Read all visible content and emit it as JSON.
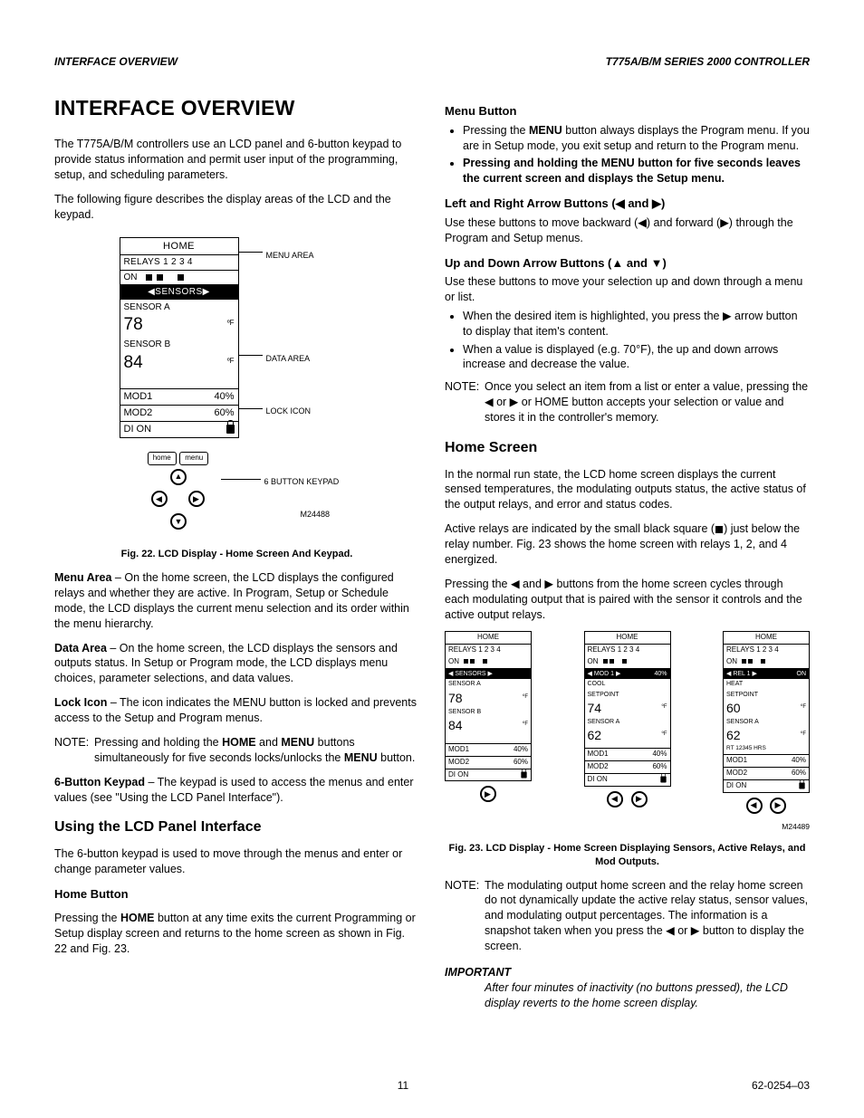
{
  "header": {
    "left": "INTERFACE OVERVIEW",
    "right": "T775A/B/M SERIES 2000 CONTROLLER"
  },
  "left": {
    "h1": "INTERFACE OVERVIEW",
    "p1": "The T775A/B/M controllers use an LCD panel and 6-button keypad to provide status information and permit user input of the programming, setup, and scheduling parameters.",
    "p2": "The following figure describes the display areas of the LCD and the keypad.",
    "fig1": {
      "home": "HOME",
      "relays": "RELAYS  1  2  3  4",
      "on": "ON",
      "sensors_hdr": "◀SENSORS▶",
      "sensor_a": "SENSOR A",
      "val_a": "78",
      "sensor_b": "SENSOR B",
      "val_b": "84",
      "deg": "ºF",
      "mod1": "MOD1",
      "mod1v": "40%",
      "mod2": "MOD2",
      "mod2v": "60%",
      "di": "DI ON",
      "btn_home": "home",
      "btn_menu": "menu",
      "callouts": {
        "menu": "MENU AREA",
        "data": "DATA AREA",
        "lock": "LOCK ICON",
        "keypad": "6 BUTTON KEYPAD",
        "code": "M24488"
      },
      "caption": "Fig. 22. LCD Display - Home Screen And Keypad."
    },
    "menu_area_label": "Menu Area",
    "menu_area": " – On the home screen, the LCD displays the configured relays and whether they are active. In Program, Setup or Schedule mode, the LCD displays the current menu selection and its order within the menu hierarchy.",
    "data_area_label": "Data Area",
    "data_area": " – On the home screen, the LCD displays the sensors and outputs status. In Setup or Program mode, the LCD displays menu choices, parameter selections, and data values.",
    "lock_icon_label": "Lock Icon",
    "lock_icon": " – The icon indicates the MENU button is locked and prevents access to the Setup and Program menus.",
    "note1_label": "NOTE:",
    "note1": "Pressing and holding the HOME and MENU buttons simultaneously for five seconds locks/unlocks the MENU button.",
    "keypad_label": "6-Button Keypad",
    "keypad": " – The keypad is used to access the menus and enter values (see \"Using the LCD Panel Interface\").",
    "h2_using": "Using the LCD Panel Interface",
    "using_p": "The 6-button keypad is used to move through the menus and enter or change parameter values.",
    "h3_home": "Home Button",
    "home_p": "Pressing the HOME button at any time exits the current Programming or Setup display screen and returns to the home screen as shown in Fig. 22 and Fig. 23."
  },
  "right": {
    "h3_menu": "Menu Button",
    "menu_li1": "Pressing the MENU button always displays the Program menu. If you are in Setup mode, you exit setup and return to the Program menu.",
    "menu_li2": "Pressing and holding the MENU button for five seconds leaves the current screen and displays the Setup menu.",
    "h3_lr": "Left and Right Arrow Buttons (◀ and ▶)",
    "lr_p": "Use these buttons to move backward (◀) and forward (▶) through the Program and Setup menus.",
    "h3_ud": "Up and Down Arrow Buttons (▲ and ▼)",
    "ud_p": "Use these buttons to move your selection up and down through a menu or list.",
    "ud_li1": "When the desired item is highlighted, you press the ▶ arrow button to display that item's content.",
    "ud_li2": "When a value is displayed (e.g. 70°F), the up and down arrows increase and decrease the value.",
    "note2_label": "NOTE:",
    "note2": "Once you select an item from a list or enter a value, pressing the ◀ or ▶ or HOME button accepts your selection or value and stores it in the controller's memory.",
    "h2_home": "Home Screen",
    "home_p1": "In the normal run state, the LCD home screen displays the current sensed temperatures, the modulating outputs status, the active status of the output relays, and error and status codes.",
    "home_p2a": "Active relays are indicated by the small black square (",
    "home_p2b": ") just below the relay number. Fig. 23 shows the home screen with relays 1, 2, and 4 energized.",
    "home_p3": "Pressing the ◀ and ▶ buttons from the home screen cycles through each modulating output that is paired with the sensor it controls and the active output relays.",
    "mini": {
      "home": "HOME",
      "relays": "RELAYS  1  2  3  4",
      "on": "ON",
      "deg": "ºF",
      "mod1": "MOD1",
      "mod1v": "40%",
      "mod2": "MOD2",
      "mod2v": "60%",
      "di": "DI ON",
      "a": {
        "hdr": "◀ SENSORS ▶",
        "l1": "SENSOR A",
        "v1": "78",
        "l2": "SENSOR B",
        "v2": "84"
      },
      "b": {
        "hdr_l": "◀ MOD 1 ▶",
        "hdr_r": "40%",
        "l1": "COOL",
        "l2": "SETPOINT",
        "v1": "74",
        "l3": "SENSOR A",
        "v2": "62"
      },
      "c": {
        "hdr_l": "◀ REL 1 ▶",
        "hdr_r": "ON",
        "l1": "HEAT",
        "l2": "SETPOINT",
        "v1": "60",
        "l3": "SENSOR A",
        "v2": "62",
        "rt": "RT 12345 HRS"
      },
      "code": "M24489"
    },
    "fig2_caption": "Fig. 23. LCD Display - Home Screen Displaying Sensors, Active Relays, and Mod Outputs.",
    "note3_label": "NOTE:",
    "note3": "The modulating output home screen and the relay home screen do not dynamically update the active relay status, sensor values, and modulating output percentages. The information is a snapshot taken when you press the  ◀ or ▶ button to display the screen.",
    "important_label": "IMPORTANT",
    "important": "After four minutes of inactivity (no buttons pressed), the LCD display reverts to the home screen display."
  },
  "footer": {
    "page": "11",
    "doc": "62-0254–03"
  }
}
